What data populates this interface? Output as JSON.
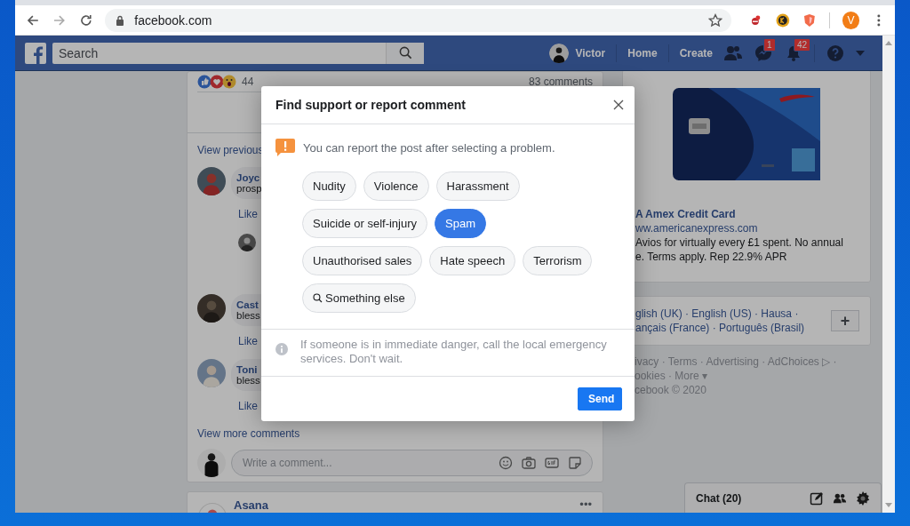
{
  "browser": {
    "url": "facebook.com",
    "profile_initial": "V"
  },
  "header": {
    "search": {
      "placeholder": "Search"
    },
    "user": "Victor",
    "nav": [
      "Home",
      "Create"
    ],
    "messages_badge": "1",
    "notifications_badge": "42"
  },
  "post": {
    "reaction_count": "44",
    "comments_count": "83 comments",
    "view_previous": "View previous",
    "comments": [
      {
        "name": "Joyc",
        "text": "prosp",
        "action": "Like",
        "has_reply": true
      },
      {
        "name": "Cast",
        "text": "bless",
        "action": "Like",
        "has_reply": false
      },
      {
        "name": "Toni",
        "text": "bless",
        "action": "Like",
        "has_reply": false
      }
    ],
    "view_more": "View more comments",
    "comment_field": {
      "placeholder": "Write a comment..."
    }
  },
  "next_post": {
    "author": "Asana",
    "menu": "•••"
  },
  "ad": {
    "title": "A Amex Credit Card",
    "url": "ww.americanexpress.com",
    "description": "Avios for virtually every £1 spent. No annual",
    "description_2": "e. Terms apply. Rep 22.9% APR"
  },
  "languages": {
    "lines": [
      "glish (UK) · English (US) · Hausa ·",
      "ançais (France) · Português (Brasil)"
    ],
    "add_button": "+"
  },
  "footer": {
    "lines": [
      "ivacy · Terms · Advertising · AdChoices ▷ ·",
      "ookies · More ▾",
      "cebook © 2020"
    ]
  },
  "chat": {
    "label": "Chat (20)"
  },
  "dialog": {
    "title": "Find support or report comment",
    "notice": "You can report the post after selecting a problem.",
    "options": [
      {
        "label": "Nudity",
        "selected": false,
        "kind": "plain"
      },
      {
        "label": "Violence",
        "selected": false,
        "kind": "plain"
      },
      {
        "label": "Harassment",
        "selected": false,
        "kind": "plain"
      },
      {
        "label": "Suicide or self-injury",
        "selected": false,
        "kind": "plain"
      },
      {
        "label": "Spam",
        "selected": true,
        "kind": "plain"
      },
      {
        "label": "Unauthorised sales",
        "selected": false,
        "kind": "plain"
      },
      {
        "label": "Hate speech",
        "selected": false,
        "kind": "plain"
      },
      {
        "label": "Terrorism",
        "selected": false,
        "kind": "plain"
      },
      {
        "label": "Something else",
        "selected": false,
        "kind": "search"
      }
    ],
    "info": "If someone is in immediate danger, call the local emergency services. Don't wait.",
    "send": "Send"
  }
}
